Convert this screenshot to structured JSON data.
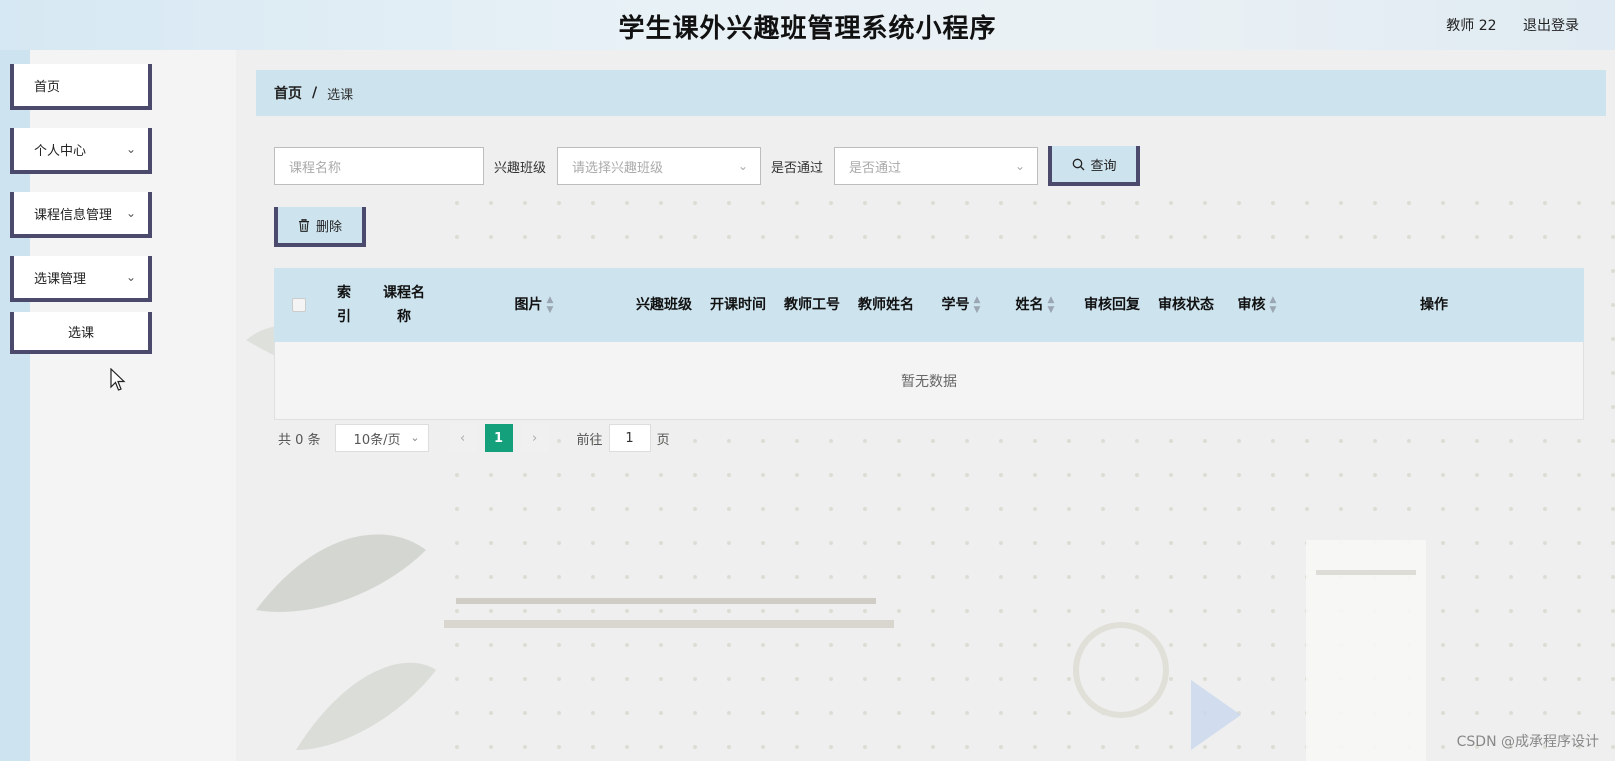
{
  "app": {
    "title": "学生课外兴趣班管理系统小程序"
  },
  "user": {
    "name": "教师 22",
    "logout": "退出登录"
  },
  "sidebar": {
    "items": [
      {
        "label": "首页",
        "has_children": false
      },
      {
        "label": "个人中心",
        "has_children": true
      },
      {
        "label": "课程信息管理",
        "has_children": true
      },
      {
        "label": "选课管理",
        "has_children": true
      },
      {
        "label": "选课",
        "has_children": false
      }
    ]
  },
  "breadcrumb": {
    "home": "首页",
    "separator": "/",
    "current": "选课"
  },
  "search": {
    "course_name_placeholder": "课程名称",
    "class_label": "兴趣班级",
    "class_placeholder": "请选择兴趣班级",
    "passed_label": "是否通过",
    "passed_placeholder": "是否通过",
    "query_button": "查询"
  },
  "actions": {
    "delete_button": "删除"
  },
  "table": {
    "columns": [
      {
        "label": "索引",
        "sortable": false
      },
      {
        "label": "课程名称",
        "sortable": true
      },
      {
        "label": "图片",
        "sortable": true
      },
      {
        "label": "兴趣班级",
        "sortable": true
      },
      {
        "label": "开课时间",
        "sortable": true
      },
      {
        "label": "教师工号",
        "sortable": true
      },
      {
        "label": "教师姓名",
        "sortable": true
      },
      {
        "label": "学号",
        "sortable": true
      },
      {
        "label": "姓名",
        "sortable": true
      },
      {
        "label": "审核回复",
        "sortable": true
      },
      {
        "label": "审核状态",
        "sortable": true
      },
      {
        "label": "审核",
        "sortable": true
      },
      {
        "label": "操作",
        "sortable": false
      }
    ],
    "rows": [],
    "empty_text": "暂无数据"
  },
  "pagination": {
    "total_text": "共 0 条",
    "page_size": "10条/页",
    "current_page": "1",
    "goto_label": "前往",
    "goto_value": "1",
    "page_unit": "页"
  },
  "watermark": "CSDN @成承程序设计",
  "colors": {
    "accent": "#cde3ee",
    "border_dark": "#4b4a6c",
    "active_page": "#14a07a"
  }
}
